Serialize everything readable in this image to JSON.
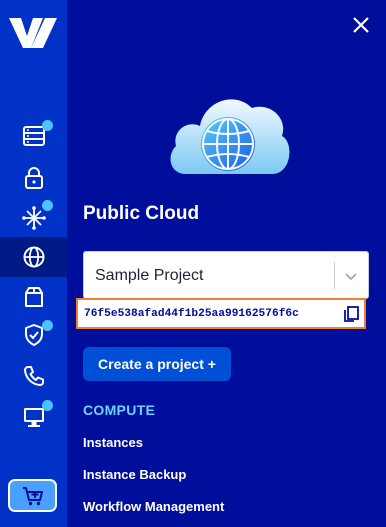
{
  "rail": {
    "logo": "ovh-logo-icon",
    "items": [
      {
        "icon": "server-icon",
        "badge": true
      },
      {
        "icon": "lock-icon",
        "badge": false
      },
      {
        "icon": "network-icon",
        "badge": true
      },
      {
        "icon": "globe-icon",
        "badge": false,
        "active": true
      },
      {
        "icon": "box-icon",
        "badge": false
      },
      {
        "icon": "shield-check-icon",
        "badge": true
      },
      {
        "icon": "phone-icon",
        "badge": false
      },
      {
        "icon": "monitor-icon",
        "badge": true
      }
    ],
    "cart_icon": "cart-add-icon"
  },
  "panel": {
    "title": "Public Cloud",
    "project_select": {
      "value": "Sample Project"
    },
    "project_id": "76f5e538afad44f1b25aa99162576f6c",
    "create_button": "Create a project +",
    "section_label": "COMPUTE",
    "nav_items": [
      "Instances",
      "Instance Backup",
      "Workflow Management"
    ]
  },
  "colors": {
    "rail_bg": "#0032c8",
    "panel_bg": "#000e9c",
    "accent": "#0050d7",
    "badge": "#4cc3ff",
    "highlight_border": "#f07f2e"
  }
}
